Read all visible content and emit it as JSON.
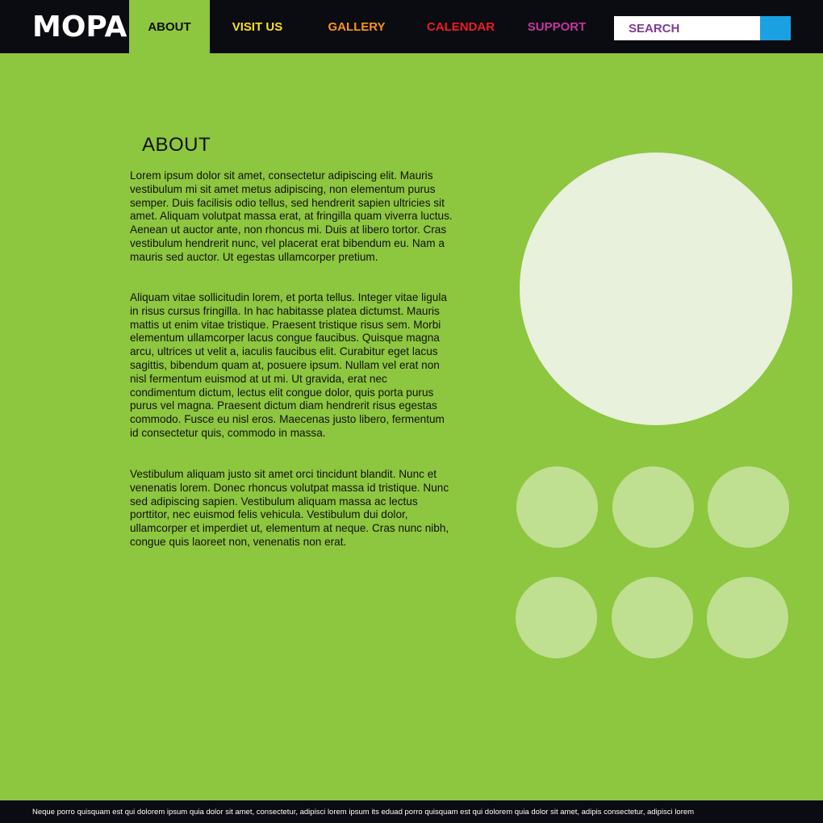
{
  "header": {
    "logo_text": "MOPA",
    "nav": [
      {
        "label": "ABOUT",
        "color": "#111111",
        "active": true
      },
      {
        "label": "VISIT US",
        "color": "#f7e11b"
      },
      {
        "label": "GALLERY",
        "color": "#f7941d"
      },
      {
        "label": "CALENDAR",
        "color": "#ed1c24"
      },
      {
        "label": "SUPPORT",
        "color": "#c2399b"
      }
    ],
    "search": {
      "placeholder": "SEARCH"
    }
  },
  "main": {
    "title": "ABOUT",
    "paragraphs": [
      "Lorem ipsum dolor sit amet, consectetur adipiscing elit. Mauris vestibulum mi sit amet metus adipiscing, non elementum purus semper. Duis facilisis odio tellus, sed hendrerit sapien ultricies sit amet. Aliquam volutpat massa erat, at fringilla quam viverra luctus. Aenean ut auctor ante, non rhoncus mi. Duis at libero tortor. Cras vestibulum hendrerit nunc, vel placerat erat bibendum eu. Nam a mauris sed auctor. Ut egestas ullamcorper pretium.",
      "Aliquam vitae sollicitudin lorem, et porta tellus. Integer vitae ligula in risus cursus fringilla. In hac habitasse platea dictumst. Mauris mattis ut enim vitae tristique. Praesent tristique risus sem. Morbi elementum ullamcorper lacus congue faucibus. Quisque magna arcu, ultrices ut velit a, iaculis faucibus elit. Curabitur eget lacus sagittis, bibendum quam at, posuere ipsum. Nullam vel erat non nisl fermentum euismod at ut mi. Ut gravida, erat nec condimentum dictum, lectus elit congue dolor, quis porta purus purus vel magna. Praesent dictum diam hendrerit risus egestas commodo. Fusce eu nisl eros. Maecenas justo libero, fermentum id consectetur quis, commodo in massa.",
      "Vestibulum aliquam justo sit amet orci tincidunt blandit. Nunc et venenatis lorem. Donec rhoncus volutpat massa id tristique. Nunc sed adipiscing sapien. Vestibulum aliquam massa ac lectus porttitor, nec euismod felis vehicula. Vestibulum dui dolor, ullamcorper et imperdiet ut, elementum at neque. Cras nunc nibh, congue quis laoreet non, venenatis non erat."
    ]
  },
  "footer": {
    "text": "Neque porro quisquam est qui dolorem ipsum quia dolor sit amet, consectetur, adipisci lorem ipsum its eduad porro quisquam est qui dolorem quia dolor sit amet, adipis  consectetur, adipisci lorem"
  },
  "colors": {
    "background": "#8dc63f",
    "bar": "#0b0b12",
    "search_button": "#1ba1e2",
    "featured_image": "#e8f1dc",
    "thumbnail": "#bfdf91"
  }
}
